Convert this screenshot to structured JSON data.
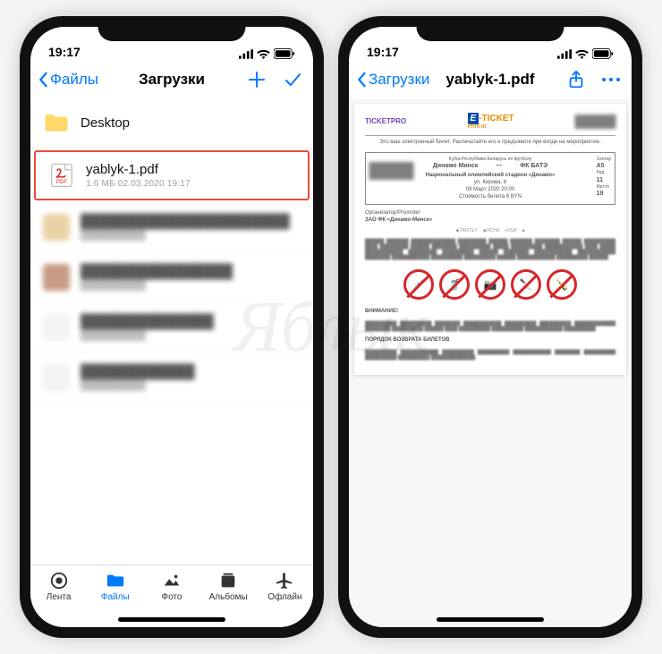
{
  "left": {
    "status": {
      "time": "19:17"
    },
    "nav": {
      "back": "Файлы",
      "title": "Загрузки"
    },
    "folder": {
      "name": "Desktop"
    },
    "file": {
      "name": "yablyk-1.pdf",
      "meta": "1.6 МБ  02.03.2020 19:17"
    },
    "tabs": {
      "feed": "Лента",
      "files": "Файлы",
      "photo": "Фото",
      "albums": "Альбомы",
      "offline": "Офлайн"
    }
  },
  "right": {
    "status": {
      "time": "19:17"
    },
    "nav": {
      "back": "Загрузки",
      "title": "yablyk-1.pdf"
    },
    "doc": {
      "brand": "TICKETPRO",
      "eticket": "-TICKET",
      "printit": "Print it!",
      "intro": "Это ваш электронный билет. Распечатайте его и предъявите при входе на мероприятие.",
      "league": "Кубок Республики Беларусь по футболу",
      "team1": "Динамо Минск",
      "team2": "ФК БАТЭ",
      "venue": "Национальный олимпийский стадион «Динамо»",
      "address": "ул. Кирова, 8",
      "date": "09 Март 2020 20:00",
      "price": "Стоимость билета  8  BYN",
      "sector_label": "Сектор",
      "sector": "A5",
      "row_label": "Ряд",
      "row": "11",
      "seat_label": "Место",
      "seat": "19",
      "organizer": "Организатор/Promoter",
      "organizer_name": "ЗАО ФК «Динамо-Минск»",
      "warn": "ВНИМАНИЕ!",
      "return": "ПОРЯДОК ВОЗВРАТА БИЛЕТОВ"
    }
  },
  "watermark": "Яблык"
}
